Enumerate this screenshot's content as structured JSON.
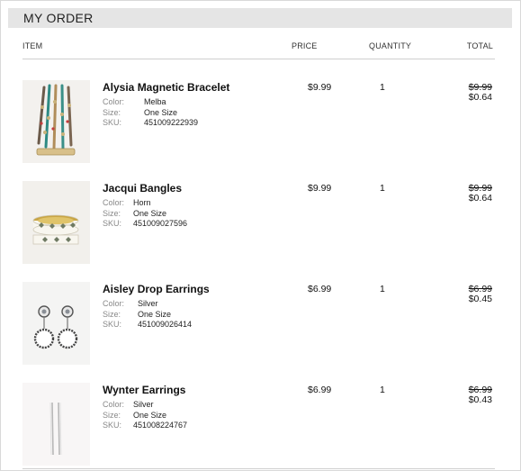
{
  "title": "MY ORDER",
  "columns": {
    "item": "ITEM",
    "price": "PRICE",
    "quantity": "QUANTITY",
    "total": "TOTAL"
  },
  "labels": {
    "color": "Color:",
    "size": "Size:",
    "sku": "SKU:"
  },
  "items": [
    {
      "name": "Alysia Magnetic Bracelet",
      "color": "Melba",
      "size": "One Size",
      "sku": "451009222939",
      "price": "$9.99",
      "quantity": "1",
      "total_original": "$9.99",
      "total_final": "$0.64",
      "image": "bracelet-image"
    },
    {
      "name": "Jacqui Bangles",
      "color": "Horn",
      "size": "One Size",
      "sku": "451009027596",
      "price": "$9.99",
      "quantity": "1",
      "total_original": "$9.99",
      "total_final": "$0.64",
      "image": "bangles-image"
    },
    {
      "name": "Aisley Drop Earrings",
      "color": "Silver",
      "size": "One Size",
      "sku": "451009026414",
      "price": "$6.99",
      "quantity": "1",
      "total_original": "$6.99",
      "total_final": "$0.45",
      "image": "drop-earrings-image"
    },
    {
      "name": "Wynter Earrings",
      "color": "Silver",
      "size": "One Size",
      "sku": "451008224767",
      "price": "$6.99",
      "quantity": "1",
      "total_original": "$6.99",
      "total_final": "$0.43",
      "image": "bar-earrings-image"
    }
  ]
}
